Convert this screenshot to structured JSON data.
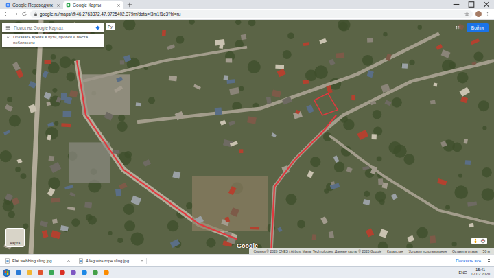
{
  "browser": {
    "tabs": [
      {
        "label": "Google Переводчик",
        "selected": false
      },
      {
        "label": "Google Карты",
        "selected": true
      }
    ],
    "address": "google.ru/maps/@46.2763372,47.9725402,379m/data=!3m1!1e3?hl=ru"
  },
  "map": {
    "search_placeholder": "Поиск на Google Картах",
    "search_suffix": "Ру",
    "suggestion": "Показать время в пути, пробки и места поблизости",
    "sign_in": "Войти",
    "layers_label": "Карта",
    "watermark": "Google",
    "attribution": [
      "Снимки © 2020 CNES / Airbus, Maxar Technologies, Данные карты © 2020 Google",
      "Казахстан",
      "Условия использования",
      "Оставить отзыв",
      "50 м"
    ]
  },
  "downloads": {
    "items": [
      "Flat webbing sling.jpg",
      "4 leg wire rope sling.jpg"
    ],
    "show_all": "Показать все"
  },
  "taskbar": {
    "lang": "ENG",
    "time": "15:41",
    "date": "02.02.2020"
  }
}
